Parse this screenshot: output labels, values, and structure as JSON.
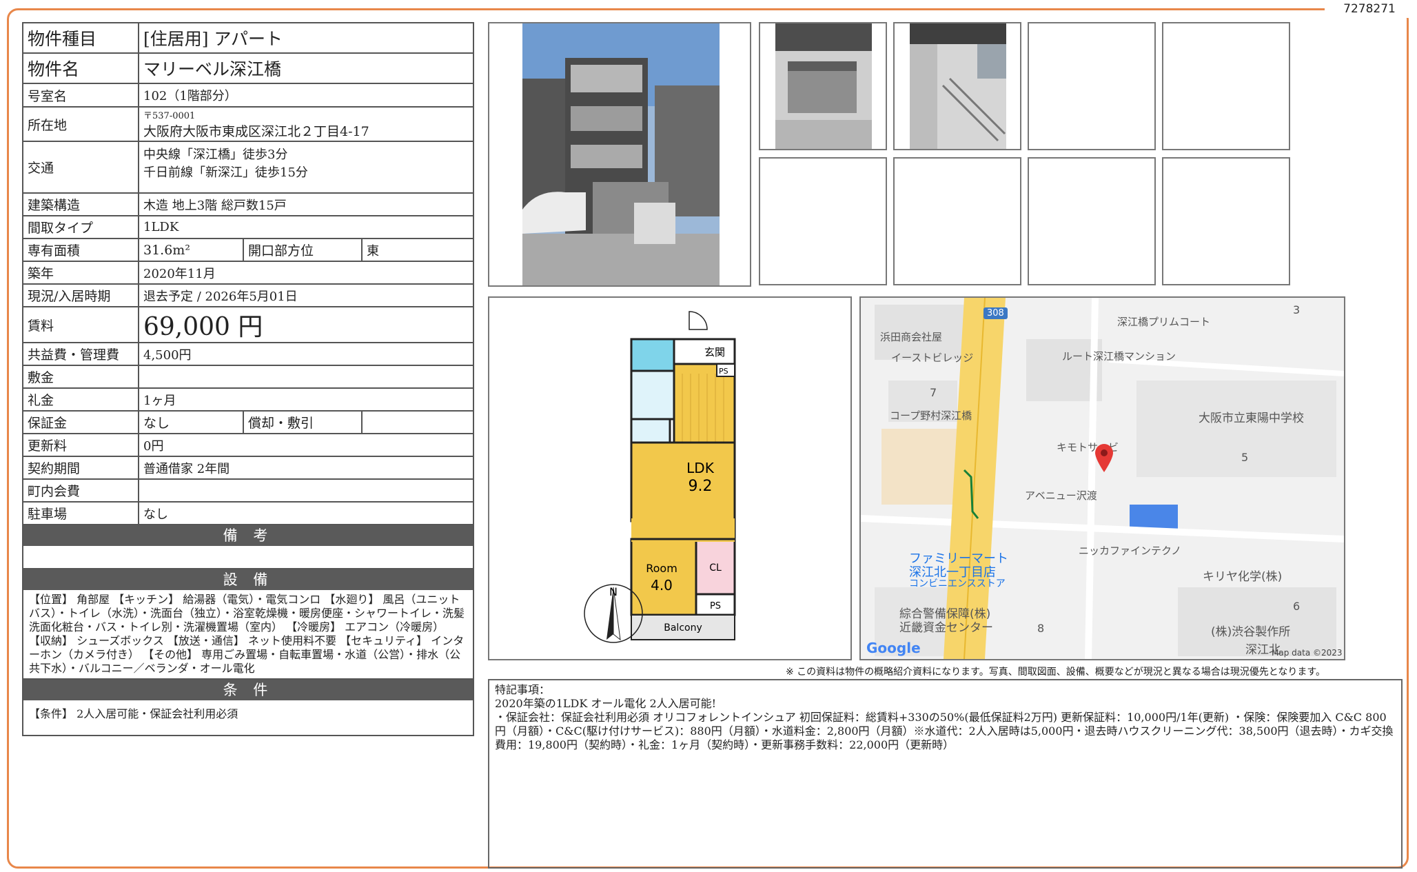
{
  "doc_id": "7278271",
  "property": {
    "type_label": "物件種目",
    "type_value": "[住居用]  アパート",
    "name_label": "物件名",
    "name_value": "マリーベル深江橋",
    "room_label": "号室名",
    "room_value": "102（1階部分）",
    "address_label": "所在地",
    "postal": "〒537-0001",
    "address_value": "大阪府大阪市東成区深江北２丁目4-17",
    "transport_label": "交通",
    "transport_1": "中央線「深江橋」徒歩3分",
    "transport_2": "千日前線「新深江」徒歩15分",
    "structure_label": "建築構造",
    "structure_value": "木造  地上3階  総戸数15戸",
    "layout_label": "間取タイプ",
    "layout_value": "1LDK",
    "area_label": "専有面積",
    "area_value": "31.6m²",
    "direction_label": "開口部方位",
    "direction_value": "東",
    "built_label": "築年",
    "built_value": "2020年11月",
    "status_label": "現況/入居時期",
    "status_value": "退去予定  /  2026年5月01日",
    "rent_label": "賃料",
    "rent_value": "69,000 円",
    "fee_label": "共益費・管理費",
    "fee_value": "4,500円",
    "deposit_label": "敷金",
    "deposit_value": "",
    "key_money_label": "礼金",
    "key_money_value": "1ヶ月",
    "guarantee_label": "保証金",
    "guarantee_value": "なし",
    "amort_label": "償却・敷引",
    "amort_value": "",
    "renewal_label": "更新料",
    "renewal_value": "0円",
    "contract_label": "契約期間",
    "contract_value": "普通借家  2年間",
    "community_label": "町内会費",
    "community_value": "",
    "parking_label": "駐車場",
    "parking_value": "なし"
  },
  "sections": {
    "remarks": "備 考",
    "equipment": "設 備",
    "conditions": "条 件"
  },
  "equipment_text": "【位置】 角部屋 【キッチン】 給湯器（電気）・電気コンロ 【水廻り】 風呂（ユニットバス）・トイレ（水洗）・洗面台（独立）・浴室乾燥機・暖房便座・シャワートイレ・洗髪洗面化粧台・バス・トイレ別・洗濯機置場（室内） 【冷暖房】 エアコン（冷暖房） 【収納】 シューズボックス 【放送・通信】 ネット使用料不要 【セキュリティ】 インターホン（カメラ付き） 【その他】 専用ごみ置場・自転車置場・水道（公営）・排水（公共下水）・バルコニー／ベランダ・オール電化",
  "conditions_text": "【条件】 2人入居可能・保証会社利用必須",
  "disclaimer": "※ この資料は物件の概略紹介資料になります。写真、間取図面、設備、概要などが現況と異なる場合は現況優先となります。",
  "special": {
    "title": "特記事項：",
    "line1": "2020年築の1LDK オール電化  2人入居可能!",
    "line2": "・保証会社：保証会社利用必須 オリコフォレントインシュア 初回保証料：総賃料+330の50%(最低保証料2万円)  更新保証料：10,000円/1年(更新) ・保険：保険要加入  C&C 800円（月額）・C&C(駆け付けサービス)：880円（月額）・水道料金：2,800円（月額）※水道代：2人入居時は5,000円・退去時ハウスクリーニング代：38,500円（退去時）・カギ交換費用：19,800円（契約時）・礼金：1ヶ月（契約時）・更新事務手数料：22,000円（更新時）"
  },
  "floorplan": {
    "entrance": "玄関",
    "ps": "PS",
    "ldk": "LDK",
    "ldk_size": "9.2",
    "room": "Room",
    "room_size": "4.0",
    "cl": "CL",
    "balcony": "Balcony",
    "north": "N"
  },
  "map": {
    "route": "308",
    "labels": [
      "浜田商会社屋",
      "イーストビレッジ",
      "コープ野村深江橋",
      "深江橋プリムコート",
      "ルート深江橋マンション",
      "大阪市立東陽中学校",
      "キモトサービ",
      "アベニュー沢渡",
      "ニッカファインテクノ",
      "キリヤ化学(株)",
      "(株)渋谷製作所",
      "綜合警備保障(株)",
      "近畿資金センター",
      "深江北"
    ],
    "store_1": "ファミリーマート",
    "store_2": "深江北一丁目店",
    "store_3": "コンビニエンスストア",
    "block_numbers": [
      "3",
      "7",
      "5",
      "6",
      "8"
    ],
    "google": "Google",
    "map_data": "Map data ©2023"
  }
}
